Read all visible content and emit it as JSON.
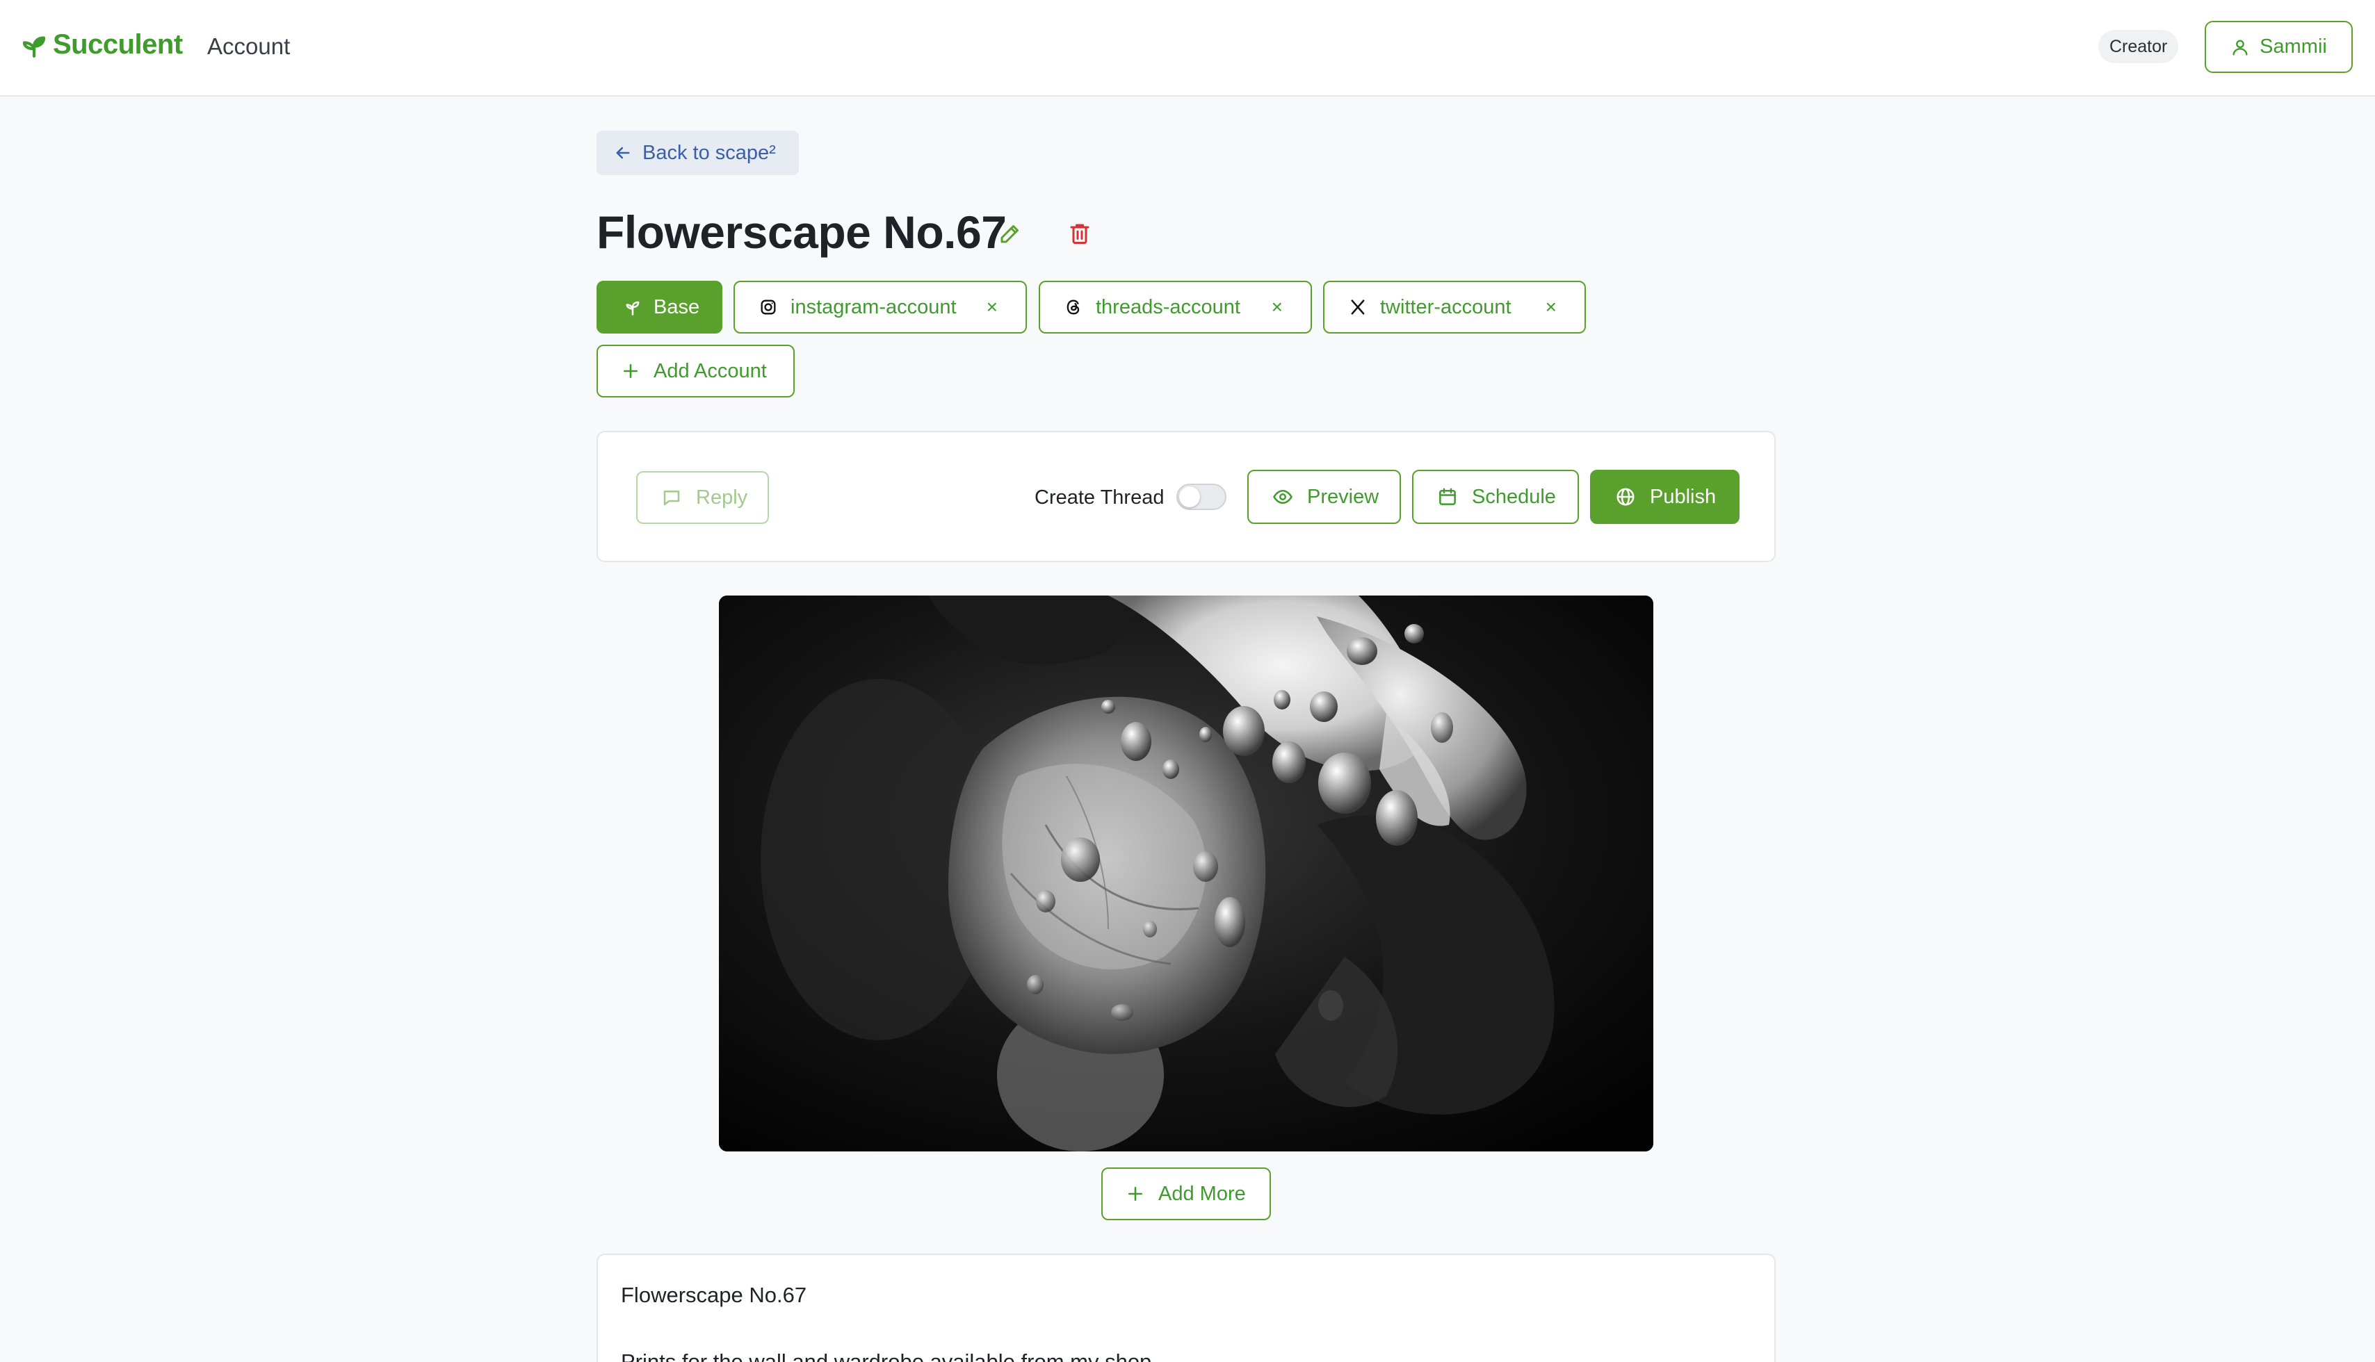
{
  "header": {
    "brand_name": "Succulent",
    "nav_label": "Account",
    "role_badge": "Creator",
    "user_name": "Sammii"
  },
  "back_button": {
    "label": "Back to scape²"
  },
  "post": {
    "title": "Flowerscape No.67"
  },
  "accounts": {
    "base_label": "Base",
    "items": [
      {
        "label": "instagram-account",
        "icon": "instagram-icon",
        "remove": "×"
      },
      {
        "label": "threads-account",
        "icon": "threads-icon",
        "remove": "×"
      },
      {
        "label": "twitter-account",
        "icon": "x-twitter-icon",
        "remove": "×"
      }
    ],
    "add_label": "Add Account"
  },
  "toolbar": {
    "reply_label": "Reply",
    "create_thread_label": "Create Thread",
    "create_thread_enabled": false,
    "preview_label": "Preview",
    "schedule_label": "Schedule",
    "publish_label": "Publish"
  },
  "media": {
    "add_more_label": "Add More"
  },
  "caption": {
    "line1": "Flowerscape No.67",
    "line2": "Prints for the wall and wardrobe available from my shop"
  },
  "colors": {
    "brand_green": "#3e9b2c",
    "button_green": "#5aa02c",
    "back_bg": "#e7ecf3",
    "delete_red": "#d33434"
  }
}
